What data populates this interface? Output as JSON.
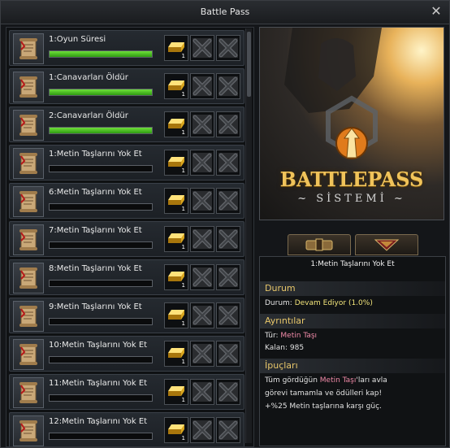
{
  "window": {
    "title": "Battle Pass",
    "close_icon": "close-icon"
  },
  "quests": [
    {
      "name": "1:Oyun Süresi",
      "progress": 1.0
    },
    {
      "name": "1:Canavarları Öldür",
      "progress": 1.0
    },
    {
      "name": "2:Canavarları Öldür",
      "progress": 1.0
    },
    {
      "name": "1:Metin Taşlarını Yok Et",
      "progress": 0.0
    },
    {
      "name": "6:Metin Taşlarını Yok Et",
      "progress": 0.0
    },
    {
      "name": "7:Metin Taşlarını Yok Et",
      "progress": 0.0
    },
    {
      "name": "8:Metin Taşlarını Yok Et",
      "progress": 0.0
    },
    {
      "name": "9:Metin Taşlarını Yok Et",
      "progress": 0.0
    },
    {
      "name": "10:Metin Taşlarını Yok Et",
      "progress": 0.0
    },
    {
      "name": "11:Metin Taşlarını Yok Et",
      "progress": 0.0
    },
    {
      "name": "12:Metin Taşlarını Yok Et",
      "progress": 0.0
    }
  ],
  "reward_count": "1",
  "banner": {
    "title": "BATTLEPASS",
    "subtitle": "~ SİSTEMİ ~"
  },
  "details": {
    "selected_quest": "1:Metin Taşlarını Yok Et",
    "status_heading": "Durum",
    "status_label": "Durum:",
    "status_value": "Devam Ediyor (1.0%)",
    "details_heading": "Ayrıntılar",
    "type_label": "Tür:",
    "type_value": "Metin Taşı",
    "remaining_label": "Kalan:",
    "remaining_value": "985",
    "tips_heading": "İpuçları",
    "tip_part1": "Tüm gördüğün ",
    "tip_part2": "Metin Taşı",
    "tip_part3": "'ları avla",
    "tip_line2": "görevi tamamla ve ödülleri kap!",
    "tip_line3": "+%25 Metin taşlarına karşı güç."
  },
  "colors": {
    "accent_gold": "#f0c35a",
    "progress_green": "#4fc71f",
    "highlight_pink": "#f08aa8",
    "highlight_yellow": "#f2e47a"
  }
}
